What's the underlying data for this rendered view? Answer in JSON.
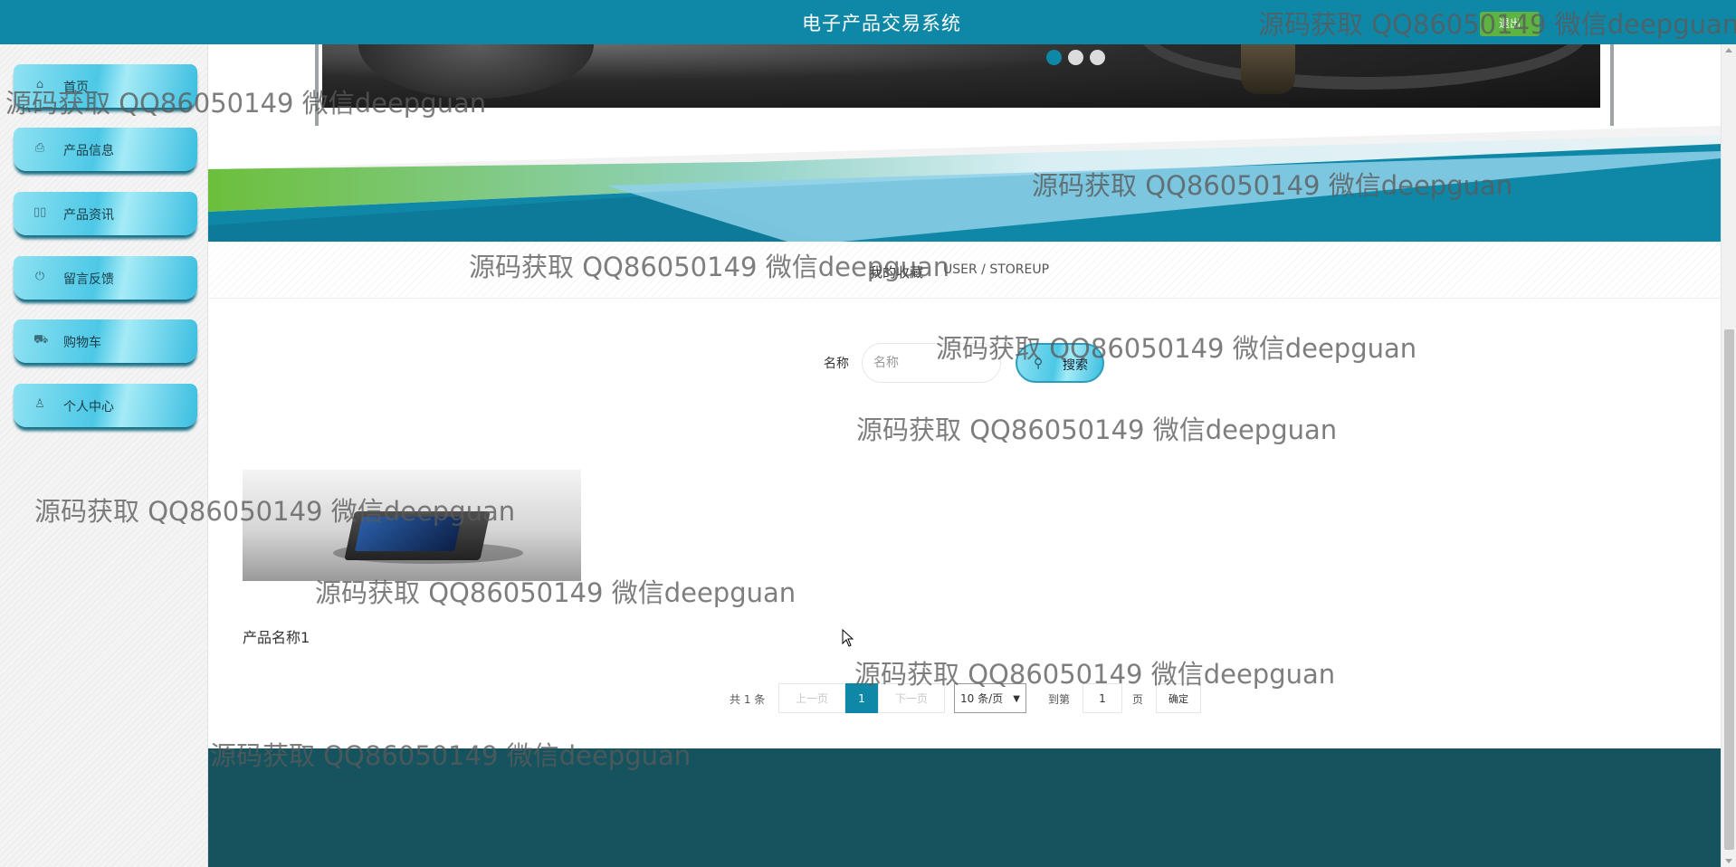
{
  "header": {
    "title": "电子产品交易系统",
    "logout_label": "退出"
  },
  "sidebar": {
    "items": [
      {
        "label": "首页",
        "icon": "home-icon"
      },
      {
        "label": "产品信息",
        "icon": "printer-icon"
      },
      {
        "label": "产品资讯",
        "icon": "news-icon"
      },
      {
        "label": "留言反馈",
        "icon": "power-icon"
      },
      {
        "label": "购物车",
        "icon": "cart-icon"
      },
      {
        "label": "个人中心",
        "icon": "user-icon"
      }
    ]
  },
  "carousel": {
    "slide_count": 3,
    "active_index": 0
  },
  "section": {
    "title": "我的收藏",
    "subtitle": "USER / STOREUP"
  },
  "search": {
    "label": "名称",
    "placeholder": "名称",
    "value": "",
    "button_label": "搜索"
  },
  "products": [
    {
      "name": "产品名称1"
    }
  ],
  "pagination": {
    "total_text": "共 1 条",
    "prev_label": "上一页",
    "current_page": "1",
    "next_label": "下一页",
    "page_size_option": "10 条/页",
    "goto_label": "到第",
    "goto_value": "1",
    "page_unit": "页",
    "confirm_label": "确定"
  },
  "watermark_text": "源码获取 QQ86050149 微信deepguan",
  "colors": {
    "accent": "#0f88a8",
    "logout_green": "#5db443",
    "footer": "#15545f"
  }
}
